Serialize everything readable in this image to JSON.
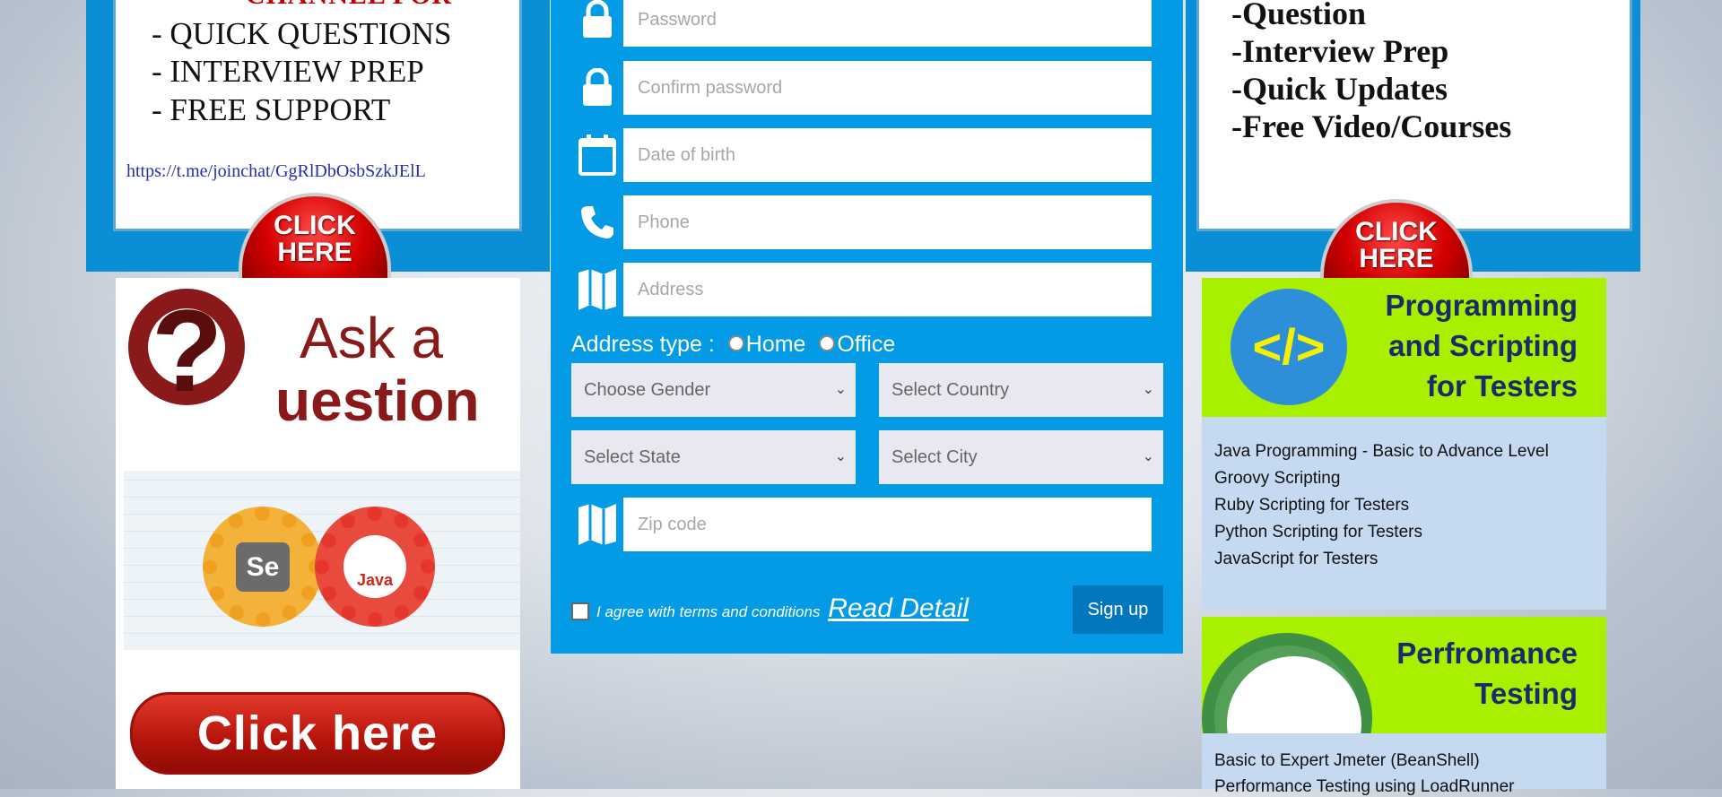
{
  "telegram_banner": {
    "title": "CHANNEL FOR",
    "lines": [
      "- QUICK QUESTIONS",
      "- INTERVIEW PREP",
      "- FREE SUPPORT"
    ],
    "link": "https://t.me/joinchat/GgRlDbOsbSzkJElL",
    "button": "CLICK HERE"
  },
  "right_banner": {
    "lines": [
      "-Question",
      "-Interview Prep",
      "-Quick Updates",
      "-Free Video/Courses"
    ],
    "button": "CLICK HERE"
  },
  "ask_ad": {
    "text1": "Ask a",
    "text2": "uestion",
    "mark": "?",
    "se_label": "Se",
    "java_label": "Java",
    "button": "Click here"
  },
  "form": {
    "password_placeholder": "Password",
    "confirm_placeholder": "Confirm password",
    "dob_placeholder": "Date of birth",
    "phone_placeholder": "Phone",
    "address_placeholder": "Address",
    "address_type_label": "Address type :",
    "home_label": "Home",
    "office_label": "Office",
    "gender": "Choose Gender",
    "country": "Select Country",
    "state": "Select State",
    "city": "Select City",
    "zip_placeholder": "Zip code",
    "terms_text": "I agree with terms and conditions",
    "read_detail": "Read Detail",
    "signup": "Sign up",
    "accent_color": "#039be5",
    "icons": [
      "lock-icon",
      "lock-icon",
      "calendar-icon",
      "phone-icon",
      "map-icon",
      "map-icon"
    ]
  },
  "programming_card": {
    "heading": [
      "Programming",
      "and Scripting",
      "for Testers"
    ],
    "code_symbol": "</>",
    "courses": [
      "Java Programming - Basic to Advance Level",
      "Groovy Scripting",
      "Ruby Scripting for Testers",
      "Python Scripting for Testers",
      "JavaScript for Testers"
    ]
  },
  "performance_card": {
    "heading": [
      "Perfromance",
      "Testing"
    ],
    "courses": [
      "Basic to Expert Jmeter (BeanShell)",
      "Performance Testing using LoadRunner"
    ]
  }
}
